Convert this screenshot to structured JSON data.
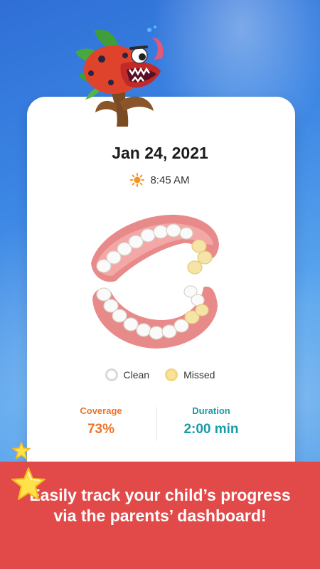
{
  "session": {
    "date": "Jan 24, 2021",
    "time": "8:45 AM"
  },
  "legend": {
    "clean_label": "Clean",
    "missed_label": "Missed"
  },
  "stats": {
    "coverage_label": "Coverage",
    "coverage_value": "73%",
    "duration_label": "Duration",
    "duration_value": "2:00 min"
  },
  "banner": {
    "text": "Easily track your child’s progress via the parents’ dashboard!"
  },
  "colors": {
    "banner": "#e24a4a",
    "coverage": "#ee7428",
    "duration": "#1a9aa6",
    "missed": "#fbe29a"
  },
  "icons": [
    "sun-icon",
    "mascot-icon",
    "star-icon"
  ]
}
